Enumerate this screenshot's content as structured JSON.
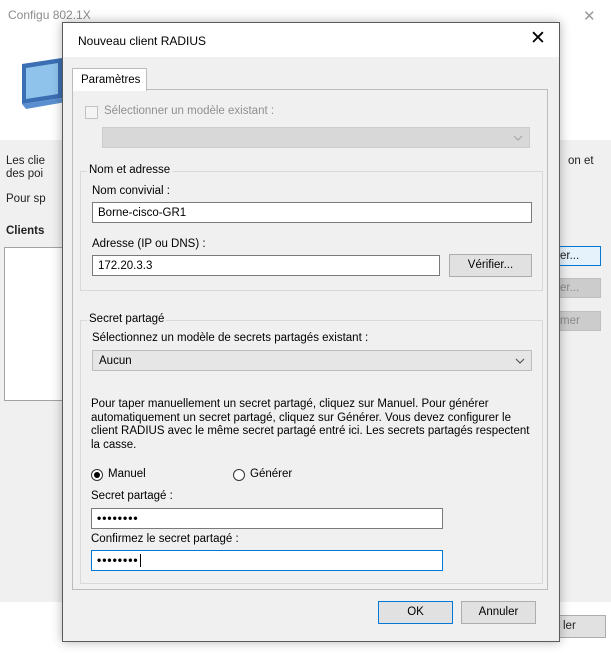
{
  "background_window": {
    "title": "Configu      802.1X",
    "text_line1": "Les clie",
    "text_line1_right": "on et",
    "text_line2": "des poi",
    "text_line3": "Pour sp",
    "clients_label": "Clients",
    "buttons": [
      "er...",
      "er...",
      "mer"
    ],
    "bottom_button": "ler"
  },
  "dialog": {
    "title": "Nouveau client RADIUS",
    "close_glyph": "✕",
    "tab_label": "Paramètres",
    "template_checkbox_label": "Sélectionner un modèle existant :",
    "template_combo_value": "",
    "name_address_group": "Nom et adresse",
    "friendly_name_label": "Nom convivial :",
    "friendly_name_value": "Borne-cisco-GR1",
    "address_label": "Adresse (IP ou DNS) :",
    "address_value": "172.20.3.3",
    "verify_button": "Vérifier...",
    "shared_secret_group": "Secret partagé",
    "secret_template_label": "Sélectionnez un modèle de secrets partagés existant :",
    "secret_template_value": "Aucun",
    "help_text": "Pour taper manuellement un secret partagé, cliquez sur Manuel. Pour générer automatiquement un secret partagé, cliquez sur Générer. Vous devez configurer le client RADIUS avec le même secret partagé entré ici. Les secrets partagés respectent la casse.",
    "radio_manual": "Manuel",
    "radio_generate": "Générer",
    "radio_selected": "Manuel",
    "shared_secret_label": "Secret partagé :",
    "shared_secret_value": "••••••••",
    "confirm_secret_label": "Confirmez le secret partagé :",
    "confirm_secret_value": "••••••••",
    "ok_button": "OK",
    "cancel_button": "Annuler"
  },
  "colors": {
    "accent": "#0078d7",
    "dialog_bg": "#f0f0f0"
  }
}
